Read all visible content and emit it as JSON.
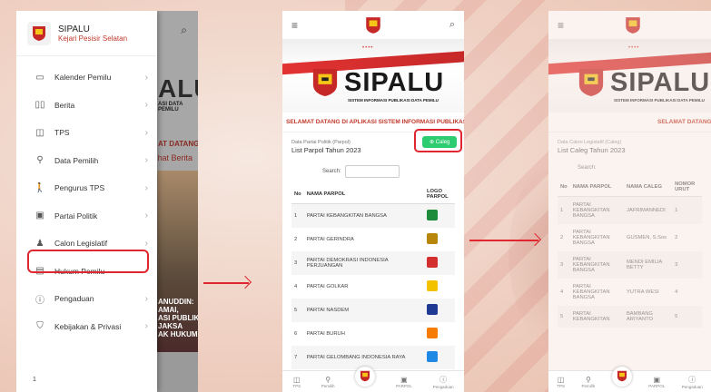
{
  "panel1": {
    "app_title": "SIPALU",
    "app_subtitle": "Kejari Pesisir Selatan",
    "menu": [
      {
        "label": "Kalender Pemilu",
        "icon": "calendar-icon"
      },
      {
        "label": "Berita",
        "icon": "book-icon"
      },
      {
        "label": "TPS",
        "icon": "box-icon"
      },
      {
        "label": "Data Pemilih",
        "icon": "person-icon"
      },
      {
        "label": "Pengurus TPS",
        "icon": "person-walk-icon"
      },
      {
        "label": "Partai Politik",
        "icon": "id-card-icon"
      },
      {
        "label": "Calon Legislatif",
        "icon": "person-stand-icon"
      },
      {
        "label": "Hukum Pemilu",
        "icon": "book-law-icon"
      },
      {
        "label": "Pengaduan",
        "icon": "alert-icon"
      },
      {
        "label": "Kebijakan & Privasi",
        "icon": "shield-icon"
      }
    ],
    "bg_logo": "ALU",
    "bg_sub": "ASI DATA PEMILU",
    "bg_welcome": "AT DATANG DI APLIKAS",
    "bg_link": "Lihat Berita",
    "bg_banner": "ANUDDIN:\nAMAI,\nASI PUBLIK\nJAKSA\nAK HUKUM\"",
    "page_number": "1"
  },
  "brand": {
    "name": "SIPALU",
    "tagline": "SISTEM INFORMASI PUBLIKASI DATA PEMILU",
    "dots": "••••"
  },
  "panel2": {
    "welcome": "SELAMAT DATANG DI APLIKASI SISTEM INFORMASI PUBLIKAS",
    "breadcrumb": "Data Partai Politik (Parpol)",
    "title": "List Parpol Tahun 2023",
    "button": "Caleg",
    "search_label": "Search:",
    "columns": [
      "No",
      "NAMA PARPOL",
      "LOGO PARPOL"
    ],
    "rows": [
      {
        "no": "1",
        "name": "PARTAI KEBANGKITAN BANGSA",
        "color": "#1e8a3c"
      },
      {
        "no": "2",
        "name": "PARTAI GERINDRA",
        "color": "#b8860b"
      },
      {
        "no": "3",
        "name": "PARTAI DEMOKRASI INDONESIA PERJUANGAN",
        "color": "#d32f2f"
      },
      {
        "no": "4",
        "name": "PARTAI GOLKAR",
        "color": "#f2c200"
      },
      {
        "no": "5",
        "name": "PARTAI NASDEM",
        "color": "#1f3a93"
      },
      {
        "no": "6",
        "name": "PARTAI BURUH",
        "color": "#f57c00"
      },
      {
        "no": "7",
        "name": "PARTAI GELOMBANG INDONESIA RAYA",
        "color": "#1e88e5"
      }
    ]
  },
  "panel3": {
    "welcome": "SELAMAT DATANG DI",
    "breadcrumb": "Data Calon Legislatif (Caleg)",
    "title": "List Caleg Tahun 2023",
    "search_label": "Search:",
    "columns": [
      "No",
      "NAMA PARPOL",
      "NAMA CALEG",
      "NOMOR URUT"
    ],
    "rows": [
      {
        "no": "1",
        "party": "PARTAI KEBANGKITAN BANGSA",
        "name": "JAFRIMANNEDI",
        "num": "1"
      },
      {
        "no": "2",
        "party": "PARTAI KEBANGKITAN BANGSA",
        "name": "GUSMEN, S.Sos",
        "num": "2"
      },
      {
        "no": "3",
        "party": "PARTAI KEBANGKITAN BANGSA",
        "name": "MENDI EMILIA BETTY",
        "num": "3"
      },
      {
        "no": "4",
        "party": "PARTAI KEBANGKITAN BANGSA",
        "name": "YUTRA WESI",
        "num": "4"
      },
      {
        "no": "5",
        "party": "PARTAI KEBANGKITAN",
        "name": "BAMBANG ARIYANTO",
        "num": "5"
      }
    ]
  },
  "bottom_nav": [
    {
      "label": "TPS"
    },
    {
      "label": "Pemilih"
    },
    {
      "label": ""
    },
    {
      "label": "PARPOL"
    },
    {
      "label": "Pengaduan"
    }
  ],
  "colors": {
    "accent": "#e0262f",
    "brand_red": "#c0392b",
    "success": "#2ecc71"
  }
}
